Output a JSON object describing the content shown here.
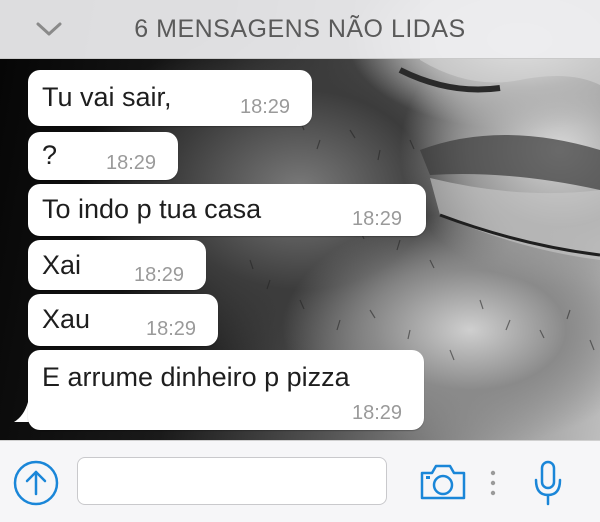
{
  "banner": {
    "unread_label": "6 MENSAGENS NÃO LIDAS"
  },
  "messages": [
    {
      "text": "Tu vai sair,",
      "time": "18:29"
    },
    {
      "text": "?",
      "time": "18:29"
    },
    {
      "text": "To indo p tua casa",
      "time": "18:29"
    },
    {
      "text": "Xai",
      "time": "18:29"
    },
    {
      "text": "Xau",
      "time": "18:29"
    },
    {
      "text": "E arrume dinheiro p pizza",
      "time": "18:29"
    }
  ],
  "input_bar": {
    "message_value": "",
    "icons": [
      "upload-icon",
      "camera-icon",
      "more-icon",
      "microphone-icon"
    ]
  },
  "colors": {
    "accent": "#1a86d8",
    "bubble": "#ffffff",
    "banner": "#eeeef0",
    "timestamp": "#9a9a9a"
  }
}
